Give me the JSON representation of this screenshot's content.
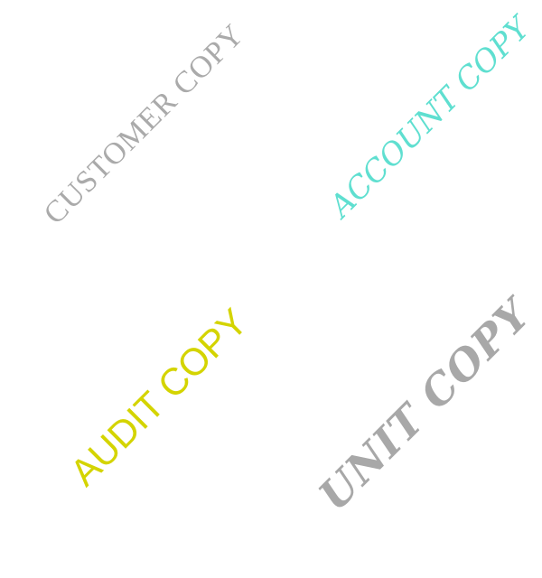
{
  "stamps": {
    "customer_copy": {
      "text": "CUSTOMER COPY",
      "color": "#aaaaaa"
    },
    "account_copy": {
      "text": "ACCOUNT COPY",
      "color": "#5fdfd0"
    },
    "audit_copy": {
      "text": "AUDIT COPY",
      "color": "#d4d400"
    },
    "unit_copy": {
      "text": "UNIT COPY",
      "color": "#a8a8a8"
    }
  }
}
